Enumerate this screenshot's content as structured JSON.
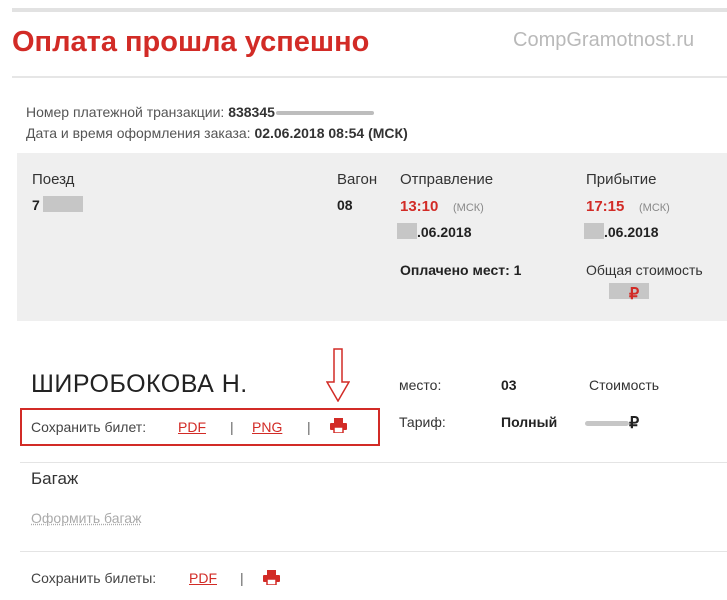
{
  "header": {
    "title": "Оплата прошла успешно",
    "watermark": "CompGramotnost.ru"
  },
  "transaction": {
    "number_label": "Номер платежной транзакции:",
    "number_value": "838345",
    "date_label": "Дата и время оформления заказа:",
    "date_value": "02.06.2018 08:54 (МСК)"
  },
  "trip": {
    "train_label": "Поезд",
    "train_value": "7",
    "car_label": "Вагон",
    "car_value": "08",
    "departure_label": "Отправление",
    "departure_time": "13:10",
    "departure_tz": "(МСК)",
    "departure_date": ".06.2018",
    "arrival_label": "Прибытие",
    "arrival_time": "17:15",
    "arrival_tz": "(МСК)",
    "arrival_date": ".06.2018",
    "paid_seats": "Оплачено мест: 1",
    "total_label": "Общая стоимость",
    "currency": "₽"
  },
  "passenger": {
    "name": "ШИРОБОКОВА Н.",
    "seat_label": "место:",
    "seat_value": "03",
    "cost_label": "Стоимость",
    "tariff_label": "Тариф:",
    "tariff_value": "Полный",
    "currency": "₽",
    "save_label": "Сохранить билет:",
    "pdf": "PDF",
    "png": "PNG",
    "divider": "|"
  },
  "baggage": {
    "title": "Багаж",
    "link": "Оформить багаж"
  },
  "footer": {
    "save_label": "Сохранить билеты:",
    "pdf": "PDF",
    "divider": "|"
  },
  "colors": {
    "accent": "#d22b26",
    "panel": "#efefef"
  },
  "icons": [
    "printer-icon",
    "down-arrow-annotation"
  ]
}
